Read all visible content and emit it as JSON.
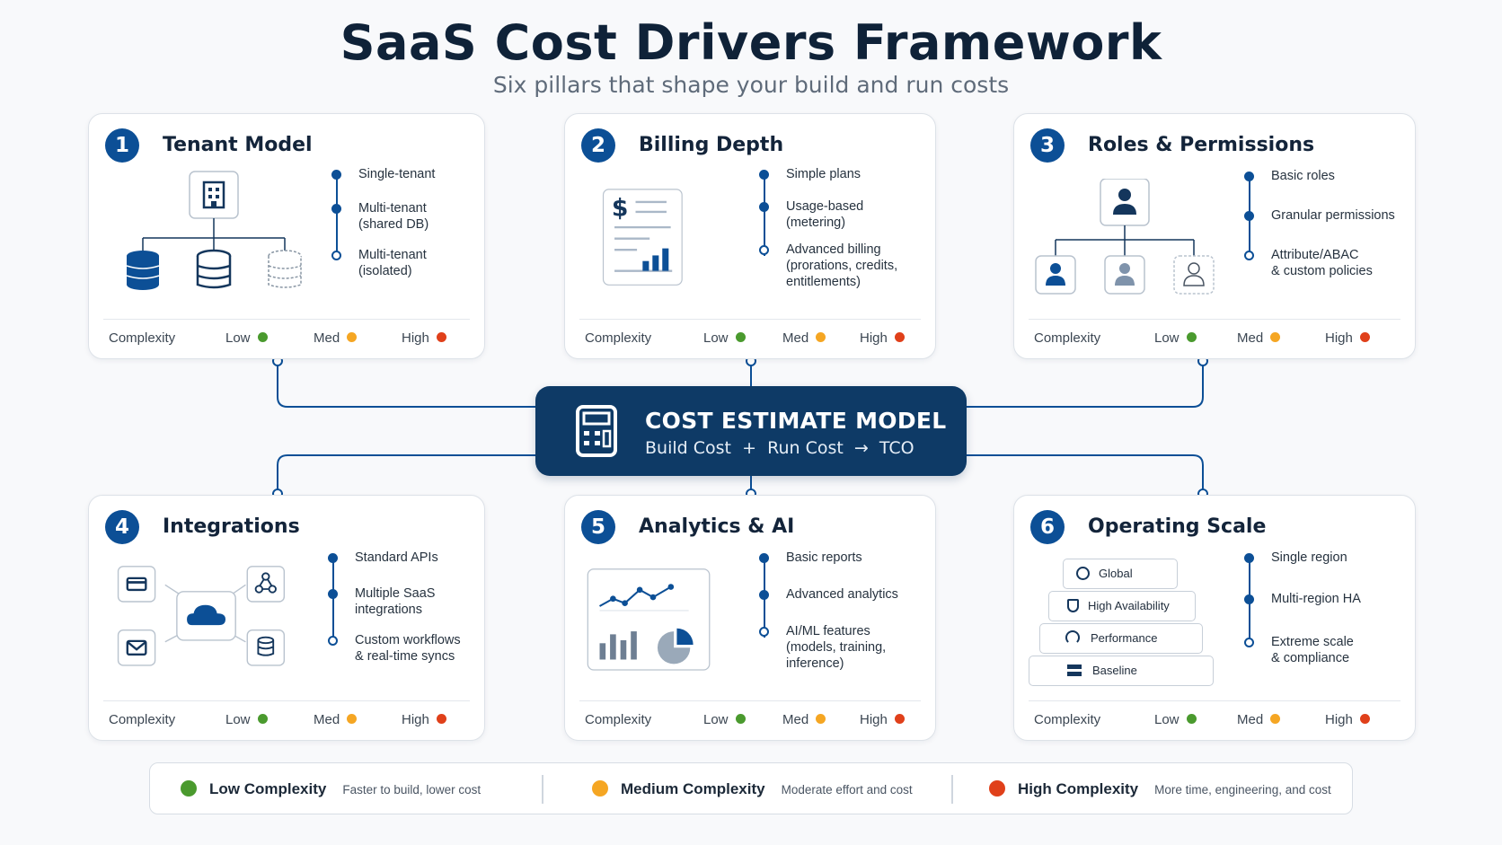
{
  "title": "SaaS Cost Drivers Framework",
  "subtitle": "Six pillars that shape your build and run costs",
  "colors": {
    "primary": "#0c4f96",
    "low": "#4a9a2e",
    "med": "#f5a623",
    "high": "#e0401a",
    "center_bg": "#0e3a66"
  },
  "complexity_label": "Complexity",
  "levels": {
    "low": "Low",
    "med": "Med",
    "high": "High"
  },
  "cards": [
    {
      "num": "1",
      "title": "Tenant Model",
      "bullets": [
        {
          "text": "Single-tenant",
          "filled": true
        },
        {
          "text": "Multi-tenant\n(shared DB)",
          "filled": true
        },
        {
          "text": "Multi-tenant\n(isolated)",
          "filled": false
        }
      ]
    },
    {
      "num": "2",
      "title": "Billing Depth",
      "bullets": [
        {
          "text": "Simple plans",
          "filled": true
        },
        {
          "text": "Usage-based\n(metering)",
          "filled": true
        },
        {
          "text": "Advanced billing\n(prorations, credits,\nentitlements)",
          "filled": false
        }
      ]
    },
    {
      "num": "3",
      "title": "Roles & Permissions",
      "bullets": [
        {
          "text": "Basic roles",
          "filled": true
        },
        {
          "text": "Granular permissions",
          "filled": true
        },
        {
          "text": "Attribute/ABAC\n& custom policies",
          "filled": false
        }
      ]
    },
    {
      "num": "4",
      "title": "Integrations",
      "bullets": [
        {
          "text": "Standard APIs",
          "filled": true
        },
        {
          "text": "Multiple SaaS\nintegrations",
          "filled": true
        },
        {
          "text": "Custom workflows\n& real-time syncs",
          "filled": false
        }
      ]
    },
    {
      "num": "5",
      "title": "Analytics & AI",
      "bullets": [
        {
          "text": "Basic reports",
          "filled": true
        },
        {
          "text": "Advanced analytics",
          "filled": true
        },
        {
          "text": "AI/ML features\n(models, training,\ninference)",
          "filled": false
        }
      ]
    },
    {
      "num": "6",
      "title": "Operating Scale",
      "bullets": [
        {
          "text": "Single region",
          "filled": true
        },
        {
          "text": "Multi-region HA",
          "filled": true
        },
        {
          "text": "Extreme scale\n& compliance",
          "filled": false
        }
      ]
    }
  ],
  "scale_stack": {
    "global": "Global",
    "ha": "High Availability",
    "performance": "Performance",
    "baseline": "Baseline"
  },
  "center": {
    "title": "COST ESTIMATE MODEL",
    "build": "Build Cost",
    "plus": "+",
    "run": "Run Cost",
    "arrow": "→",
    "tco": "TCO"
  },
  "legend": [
    {
      "title": "Low Complexity",
      "desc": "Faster to build, lower cost",
      "color": "#4a9a2e"
    },
    {
      "title": "Medium Complexity",
      "desc": "Moderate effort and cost",
      "color": "#f5a623"
    },
    {
      "title": "High Complexity",
      "desc": "More time, engineering, and cost",
      "color": "#e0401a"
    }
  ]
}
